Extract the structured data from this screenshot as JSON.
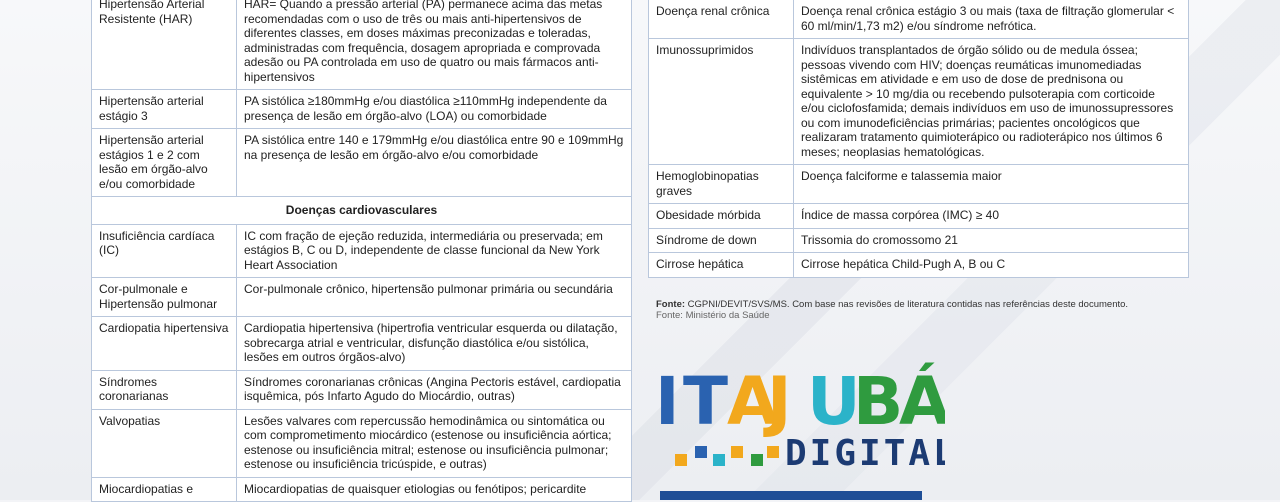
{
  "left_rows": [
    {
      "term": "Hipertensão Arterial Resistente (HAR)",
      "desc": "HAR= Quando a pressão arterial (PA) permanece acima das metas recomendadas com o uso de três ou mais anti-hipertensivos de diferentes classes, em doses máximas preconizadas e toleradas, administradas com frequência, dosagem apropriada e comprovada adesão ou PA controlada em uso de quatro ou mais fármacos anti-hipertensivos"
    },
    {
      "term": "Hipertensão arterial estágio 3",
      "desc": "PA sistólica ≥180mmHg e/ou diastólica ≥110mmHg independente da presença de lesão em órgão-alvo (LOA) ou comorbidade"
    },
    {
      "term": "Hipertensão arterial estágios 1 e 2 com lesão em órgão-alvo e/ou comorbidade",
      "desc": "PA sistólica entre 140 e 179mmHg e/ou diastólica entre 90 e 109mmHg na presença de lesão em órgão-alvo e/ou comorbidade"
    }
  ],
  "section_title": "Doenças cardiovasculares",
  "cardio_rows": [
    {
      "term": "Insuficiência cardíaca (IC)",
      "desc": "IC com fração de ejeção reduzida, intermediária ou preservada; em estágios B, C ou D, independente de classe funcional da New York Heart Association"
    },
    {
      "term": "Cor-pulmonale e Hipertensão pulmonar",
      "desc": "Cor-pulmonale crônico, hipertensão pulmonar primária ou secundária"
    },
    {
      "term": "Cardiopatia hipertensiva",
      "desc": "Cardiopatia hipertensiva (hipertrofia ventricular esquerda ou dilatação, sobrecarga atrial e ventricular, disfunção diastólica e/ou sistólica, lesões em outros órgãos-alvo)"
    },
    {
      "term": "Síndromes coronarianas",
      "desc": "Síndromes coronarianas crônicas (Angina Pectoris estável, cardiopatia isquêmica, pós Infarto Agudo do Miocárdio, outras)"
    },
    {
      "term": "Valvopatias",
      "desc": "Lesões valvares com repercussão hemodinâmica ou sintomática ou com comprometimento miocárdico (estenose ou insuficiência aórtica; estenose ou insuficiência mitral; estenose ou insuficiência pulmonar; estenose ou insuficiência tricúspide, e outras)"
    },
    {
      "term": "Miocardiopatias e",
      "desc": "Miocardiopatias de quaisquer etiologias ou fenótipos; pericardite"
    }
  ],
  "right_rows": [
    {
      "term": "",
      "desc": ""
    },
    {
      "term": "Doença renal crônica",
      "desc": "Doença renal crônica estágio 3 ou mais (taxa de filtração glomerular < 60 ml/min/1,73 m2) e/ou síndrome nefrótica."
    },
    {
      "term": "Imunossuprimidos",
      "desc": "Indivíduos transplantados de órgão sólido ou de medula óssea; pessoas vivendo com HIV; doenças reumáticas imunomediadas sistêmicas em atividade e em uso de dose de prednisona ou equivalente > 10 mg/dia ou recebendo pulsoterapia com corticoide e/ou ciclofosfamida; demais indivíduos em uso de imunossupressores ou com imunodeficiências primárias; pacientes oncológicos que realizaram tratamento quimioterápico ou radioterápico nos últimos 6 meses; neoplasias hematológicas."
    },
    {
      "term": "Hemoglobinopatias graves",
      "desc": "Doença falciforme e talassemia maior"
    },
    {
      "term": "Obesidade mórbida",
      "desc": "Índice de massa corpórea (IMC) ≥ 40"
    },
    {
      "term": "Síndrome de down",
      "desc": "Trissomia do cromossomo 21"
    },
    {
      "term": "Cirrose hepática",
      "desc": "Cirrose hepática Child-Pugh A, B ou C"
    }
  ],
  "source": {
    "label": "Fonte:",
    "text": "CGPNI/DEVIT/SVS/MS. Com base nas revisões de literatura contidas nas referências deste documento.",
    "sub": "Fonte: Ministério da Saúde"
  },
  "logo": {
    "letters": [
      "I",
      "T",
      "A",
      "J",
      "U",
      "B",
      "Á"
    ],
    "letter_colors": [
      "#2a62b0",
      "#2a62b0",
      "#f2a81d",
      "#f2a81d",
      "#2bb3c9",
      "#2f9b3f",
      "#2f9b3f"
    ],
    "word2": "DIGITAL",
    "dot_colors": [
      "#f2a81d",
      "#2a62b0",
      "#2bb3c9",
      "#f2a81d",
      "#2f9b3f"
    ]
  }
}
